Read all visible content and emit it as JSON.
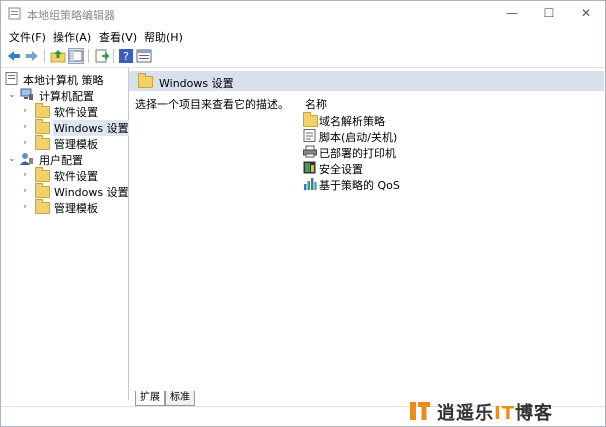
{
  "window": {
    "title": "本地组策略编辑器",
    "controls": {
      "minimize": "—",
      "maximize": "☐",
      "close": "✕"
    }
  },
  "menu": [
    {
      "label": "文件(F)"
    },
    {
      "label": "操作(A)"
    },
    {
      "label": "查看(V)"
    },
    {
      "label": "帮助(H)"
    }
  ],
  "toolbar": {
    "icons": [
      "back-icon",
      "forward-icon",
      "up-folder-icon",
      "show-hide-tree-icon",
      "export-list-icon",
      "help-icon",
      "properties-icon"
    ]
  },
  "tree": {
    "root": "本地计算机 策略",
    "computer_config": "计算机配置",
    "computer_children": [
      "软件设置",
      "Windows 设置",
      "管理模板"
    ],
    "user_config": "用户配置",
    "user_children": [
      "软件设置",
      "Windows 设置",
      "管理模板"
    ],
    "selected": "计算机配置/Windows 设置"
  },
  "content": {
    "header_title": "Windows 设置",
    "description": "选择一个项目来查看它的描述。",
    "column_name": "名称",
    "items": [
      {
        "label": "域名解析策略",
        "icon": "folder-icon"
      },
      {
        "label": "脚本(启动/关机)",
        "icon": "script-icon"
      },
      {
        "label": "已部署的打印机",
        "icon": "printer-icon"
      },
      {
        "label": "安全设置",
        "icon": "security-icon"
      },
      {
        "label": "基于策略的 QoS",
        "icon": "qos-chart-icon"
      }
    ]
  },
  "tabs": [
    {
      "label": "扩展"
    },
    {
      "label": "标准"
    }
  ],
  "watermark": {
    "text_prefix": "逍遥乐",
    "text_it": "IT",
    "text_suffix": "博客"
  },
  "colors": {
    "accent_header": "#d7e0ec",
    "selection": "#dfe6ef",
    "watermark_orange": "#f08a1c"
  }
}
